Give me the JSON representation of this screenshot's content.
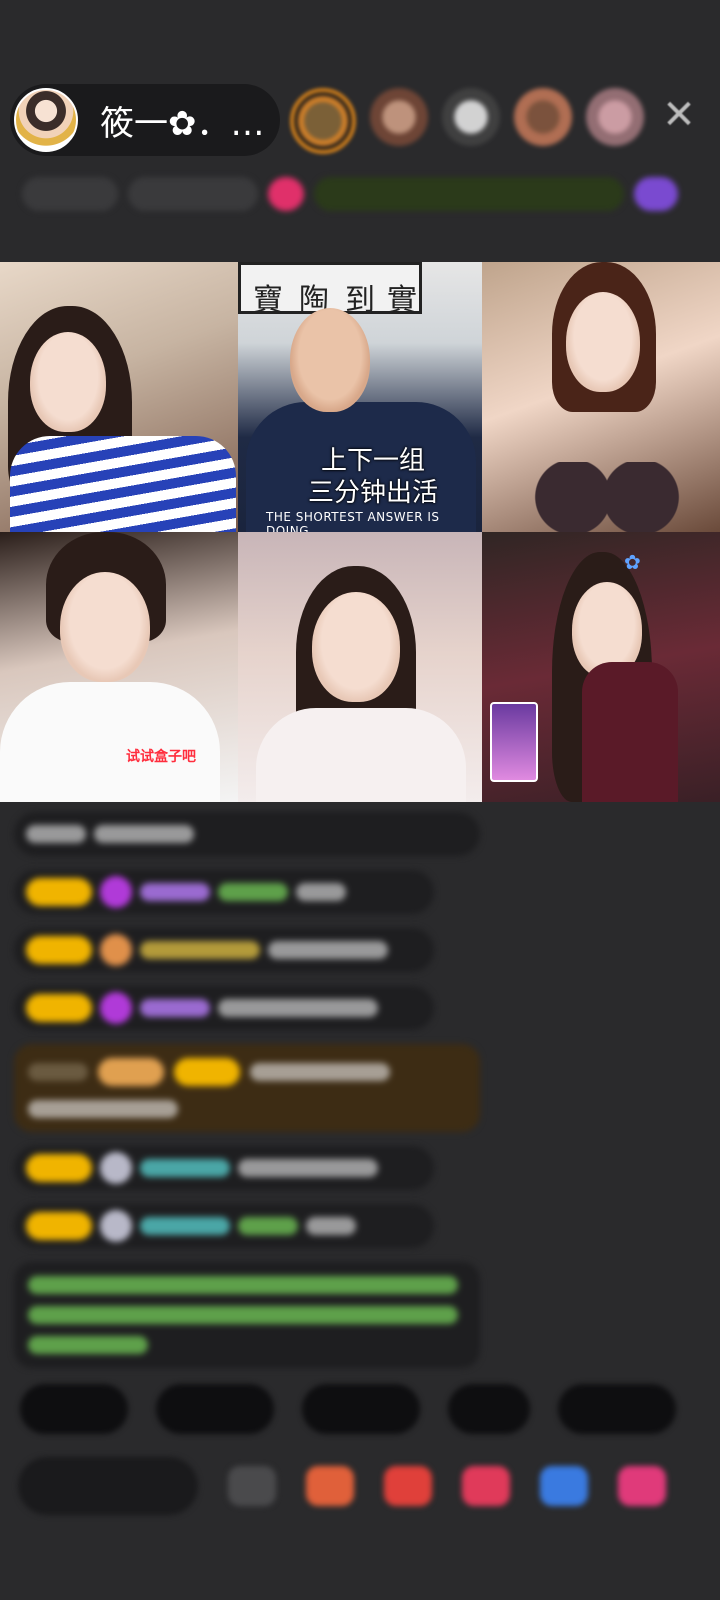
{
  "host": {
    "name": "筱一✿．…",
    "avatar_icon": "host-avatar-image"
  },
  "audience": {
    "avatars": [
      "viewer-1",
      "viewer-2",
      "viewer-3",
      "viewer-4",
      "viewer-5"
    ],
    "close_icon": "close-icon"
  },
  "video_grid": {
    "cells": [
      {
        "id": "guest-1"
      },
      {
        "id": "guest-2",
        "subtitle_line1": "上下一组",
        "subtitle_line2": "三分钟出活",
        "shirt_text": "THE SHORTEST ANSWER IS DOING"
      },
      {
        "id": "guest-3"
      },
      {
        "id": "guest-4",
        "overlay_text": "试试盒子吧"
      },
      {
        "id": "guest-5"
      },
      {
        "id": "guest-6"
      }
    ]
  },
  "colors": {
    "background": "#2a2a2c",
    "subtitle_text": "#ffffff",
    "hint_text": "#ff2d3d",
    "badge": "#f0b400"
  }
}
